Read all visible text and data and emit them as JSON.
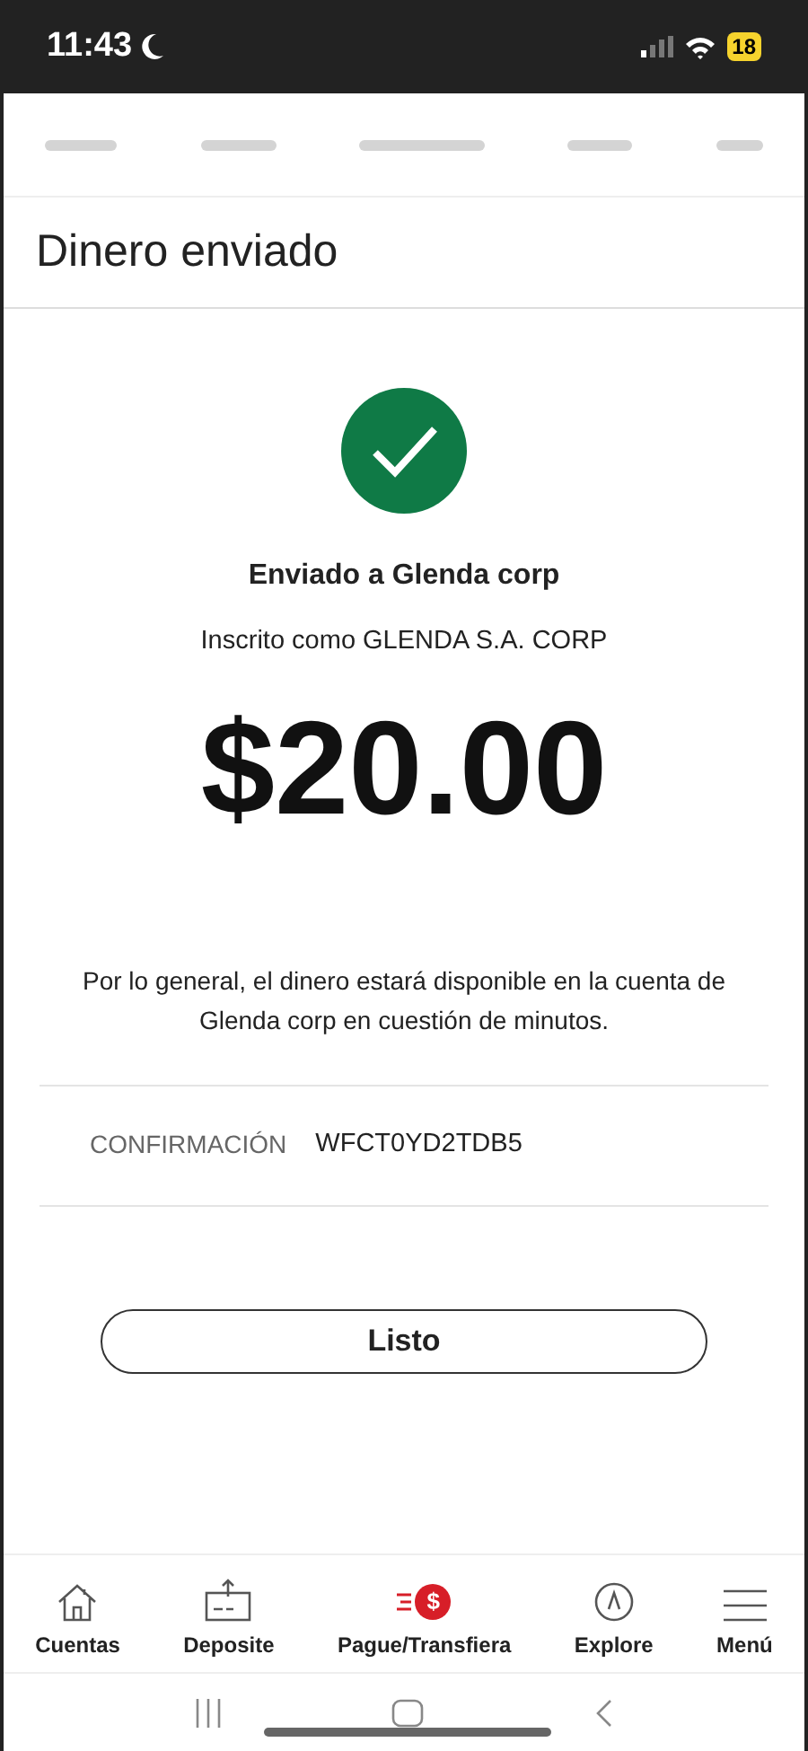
{
  "status_bar": {
    "time": "11:43",
    "battery": "18"
  },
  "header": {
    "title": "Dinero enviado"
  },
  "result": {
    "recipient": "Enviado a Glenda corp",
    "enrolled_as": "Inscrito como GLENDA S.A. CORP",
    "amount": "$20.00",
    "note": "Por lo general, el dinero estará disponible en la cuenta de Glenda corp en cuestión de minutos."
  },
  "confirmation": {
    "label": "CONFIRMACIÓN",
    "value": "WFCT0YD2TDB5"
  },
  "done_button": "Listo",
  "bottom_nav": [
    {
      "kind": "home",
      "label": "Cuentas"
    },
    {
      "kind": "deposit",
      "label": "Deposite"
    },
    {
      "kind": "pay",
      "label": "Pague/Transfiera",
      "symbol": "$"
    },
    {
      "kind": "explore",
      "label": "Explore"
    },
    {
      "kind": "menu",
      "label": "Menú"
    }
  ]
}
